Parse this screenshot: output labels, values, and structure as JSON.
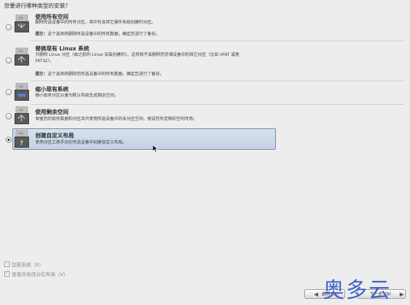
{
  "question": "您要进行哪种类型的安装？",
  "options": [
    {
      "title": "使用所有空间",
      "desc": [
        "删除所选设备中的所有分区，其中包含其它操作系统创建的分区。"
      ],
      "note_label": "提示：",
      "note_text": "这个选项将删除所选设备中的所有数据，确定您进行了备份。",
      "selected": false
    },
    {
      "title": "替换现有 Linux 系统",
      "desc": [
        "只删除 Linux 分区（由之前的 Linux 安装创建的）。这样就不会删除您存储设备中的其它分区（比如 VFAT 或者",
        "FAT32）。"
      ],
      "note_label": "提示：",
      "note_text": "这个选项将删除您所选设备中的所有数据，确定您进行了备份。",
      "selected": false
    },
    {
      "title": "缩小现有系统",
      "desc": [
        "缩小现有分区以便为默认布局生成剩余空间。"
      ],
      "selected": false
    },
    {
      "title": "使用剩余空间",
      "desc": [
        "保留您的现有数据和分区且只使用所选设备中的未分区空间，假设您有足够的空间可用。"
      ],
      "selected": false
    },
    {
      "title": "创建自定义布局",
      "desc": [
        "使用分区工具手动在所选设备中创建自定义布局。"
      ],
      "selected": true
    }
  ],
  "encrypt_system": {
    "label": "加密系统（E）",
    "checked": false
  },
  "review_layout": {
    "label": "查看并修改分区布局（V）",
    "checked": true
  },
  "buttons": {
    "back": "返回（B）",
    "next": "下一步（N）"
  },
  "watermark": "奥多云",
  "colors": {
    "accent": "#3f63c9",
    "selection": "#c9d6e8"
  },
  "icons": [
    "drive-delete-icon",
    "drive-replace-icon",
    "drive-shrink-icon",
    "drive-free-space-icon",
    "custom-layout-icon"
  ]
}
